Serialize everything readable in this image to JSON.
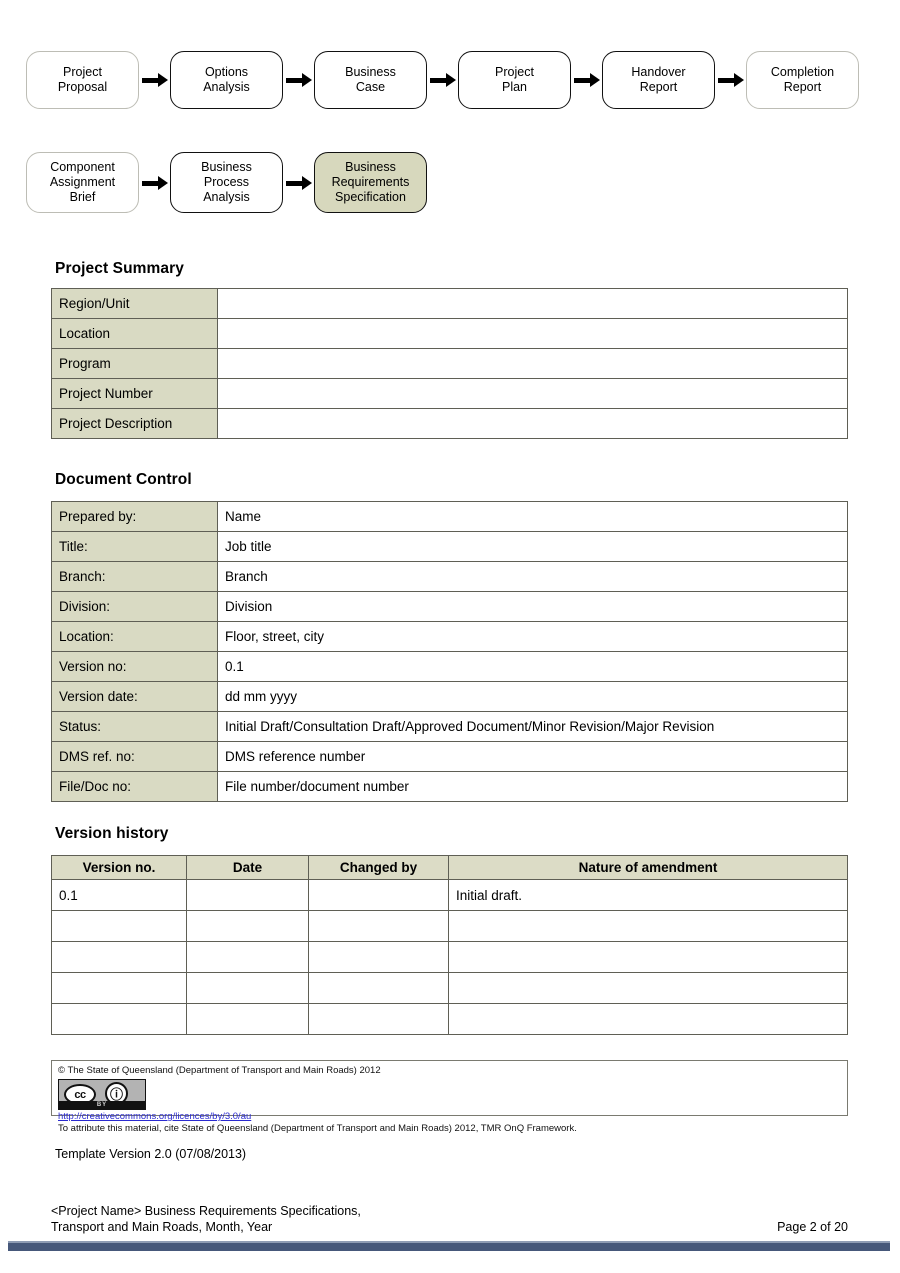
{
  "flowchart": {
    "row1": [
      {
        "label": "Project\nProposal",
        "highlight": false,
        "soft": true
      },
      {
        "label": "Options\nAnalysis",
        "highlight": false,
        "soft": false
      },
      {
        "label": "Business\nCase",
        "highlight": false,
        "soft": false
      },
      {
        "label": "Project\nPlan",
        "highlight": false,
        "soft": false
      },
      {
        "label": "Handover\nReport",
        "highlight": false,
        "soft": false
      },
      {
        "label": "Completion\nReport",
        "highlight": false,
        "soft": true
      }
    ],
    "row2": [
      {
        "label": "Component\nAssignment\nBrief",
        "highlight": false,
        "soft": true
      },
      {
        "label": "Business\nProcess\nAnalysis",
        "highlight": false,
        "soft": false
      },
      {
        "label": "Business\nRequirements\nSpecification",
        "highlight": true,
        "soft": false
      }
    ],
    "highlight_color": "#d7d8bd",
    "arrow_icon": "arrow-right-icon"
  },
  "project_summary": {
    "title": "Project Summary",
    "rows": [
      {
        "label": "Region/Unit",
        "value": ""
      },
      {
        "label": "Location",
        "value": ""
      },
      {
        "label": "Program",
        "value": ""
      },
      {
        "label": "Project Number",
        "value": ""
      },
      {
        "label": "Project Description",
        "value": ""
      }
    ]
  },
  "document_control": {
    "title": "Document Control",
    "rows": [
      {
        "label": "Prepared by:",
        "value": "Name"
      },
      {
        "label": "Title:",
        "value": "Job title"
      },
      {
        "label": "Branch:",
        "value": "Branch"
      },
      {
        "label": "Division:",
        "value": "Division"
      },
      {
        "label": "Location:",
        "value": "Floor, street, city"
      },
      {
        "label": "Version no:",
        "value": "0.1"
      },
      {
        "label": "Version date:",
        "value": "dd mm yyyy"
      },
      {
        "label": "Status:",
        "value": "Initial Draft/Consultation Draft/Approved Document/Minor Revision/Major Revision"
      },
      {
        "label": "DMS ref. no:",
        "value": "DMS reference number"
      },
      {
        "label": "File/Doc no:",
        "value": "File number/document number"
      }
    ]
  },
  "version_history": {
    "title": "Version history",
    "headers": [
      "Version no.",
      "Date",
      "Changed by",
      "Nature of amendment"
    ],
    "rows": [
      [
        "0.1",
        "",
        "",
        "Initial draft."
      ],
      [
        "",
        "",
        "",
        ""
      ],
      [
        "",
        "",
        "",
        ""
      ],
      [
        "",
        "",
        "",
        ""
      ],
      [
        "",
        "",
        "",
        ""
      ]
    ]
  },
  "copyright": {
    "line1": "© The State of Queensland (Department of Transport and Main Roads) 2012",
    "badge": {
      "cc": "cc",
      "by_symbol": "ⓘ",
      "by_label": "BY"
    },
    "link": "http://creativecommons.org/licences/by/3.0/au",
    "attribution": "To attribute this material, cite State of Queensland (Department of Transport and Main Roads) 2012, TMR OnQ Framework.",
    "link_color": "#2a2ad0"
  },
  "template_version": "Template Version 2.0 (07/08/2013)",
  "footer": {
    "doc_title_line1": "<Project Name> Business Requirements Specifications,",
    "doc_title_line2": "Transport and Main Roads, Month, Year",
    "page_number": "Page 2 of 20",
    "bar_color": "#46587a"
  }
}
